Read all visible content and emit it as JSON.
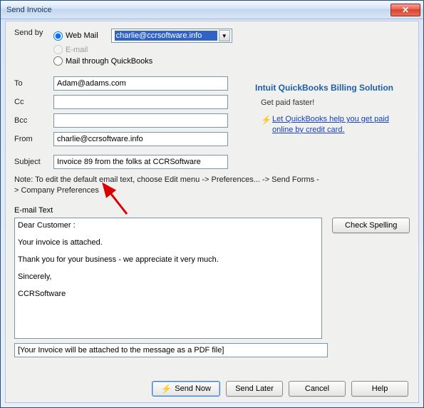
{
  "window": {
    "title": "Send Invoice"
  },
  "sendby": {
    "label": "Send by",
    "options": {
      "webmail": "Web Mail",
      "email": "E-mail",
      "mailqb": "Mail through QuickBooks"
    },
    "dropdown_value": "charlie@ccrsoftware.info"
  },
  "fields": {
    "to_label": "To",
    "to_value": "Adam@adams.com",
    "cc_label": "Cc",
    "cc_value": "",
    "bcc_label": "Bcc",
    "bcc_value": "",
    "from_label": "From",
    "from_value": "charlie@ccrsoftware.info",
    "subject_label": "Subject",
    "subject_value": "Invoice 89 from the folks at CCRSoftware"
  },
  "promo": {
    "title": "Intuit QuickBooks Billing Solution",
    "subtitle": "Get paid faster!",
    "link1": "Let QuickBooks help you get",
    "link2": "paid online by credit card."
  },
  "note": "Note: To edit the default email text, choose Edit menu -> Preferences... -> Send Forms -> Company Preferences",
  "email_text_label": "E-mail Text",
  "email_body": "Dear Customer :\n\nYour invoice is attached.\n\nThank you for your business - we appreciate it very much.\n\nSincerely,\n\nCCRSoftware",
  "check_spelling": "Check Spelling",
  "attach_note": "[Your Invoice will be attached to the message as a PDF file]",
  "buttons": {
    "send_now": "Send Now",
    "send_later": "Send Later",
    "cancel": "Cancel",
    "help": "Help"
  }
}
